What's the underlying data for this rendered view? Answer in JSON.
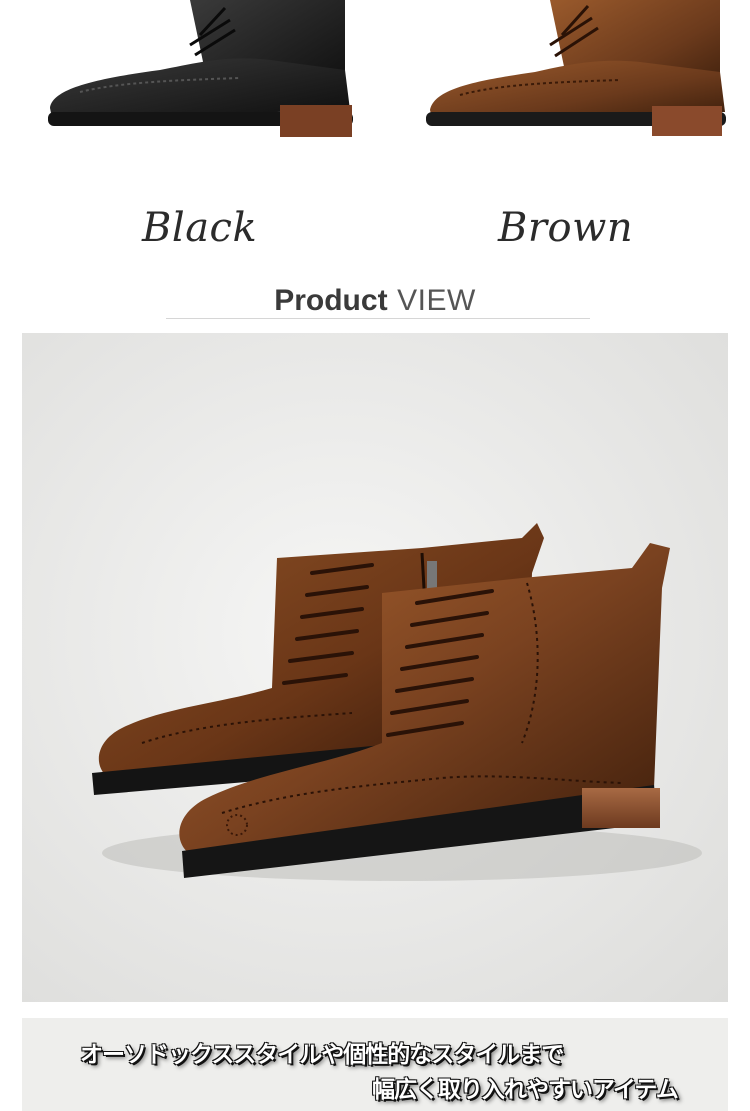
{
  "colors": {
    "items": [
      {
        "label": "Black",
        "color": "#1c1c1c"
      },
      {
        "label": "Brown",
        "color": "#6b3a1c"
      }
    ]
  },
  "section": {
    "title_bold": "Product",
    "title_light": "VIEW"
  },
  "banner": {
    "line1": "オーソドックススタイルや個性的なスタイルまで",
    "line2": "幅広く取り入れやすいアイテム"
  },
  "palette": {
    "background": "#ffffff",
    "photo_bg": "#ececec",
    "leather_brown": "#6b3a1c",
    "leather_black": "#1c1c1c",
    "sole": "#8a4a2c"
  }
}
